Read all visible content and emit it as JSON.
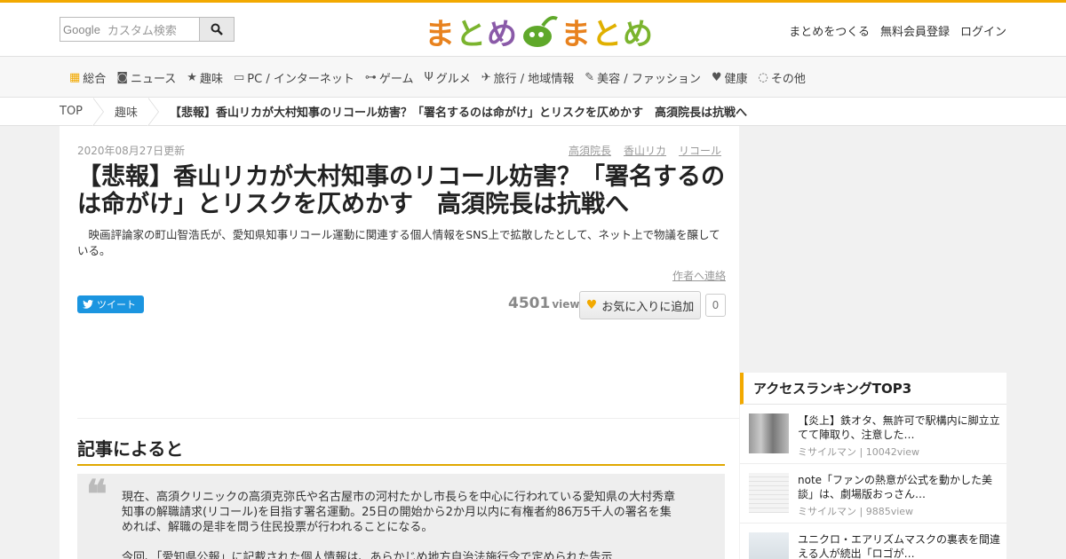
{
  "header": {
    "search_brand": "Google",
    "search_placeholder": "カスタム検索",
    "logo": [
      "ま",
      "と",
      "め",
      "ま",
      "と",
      "め"
    ],
    "links": [
      "まとめをつくる",
      "無料会員登録",
      "ログイン"
    ]
  },
  "colors": {
    "accent": "#f2a900",
    "tweet": "#1b95e0",
    "logo_orange": "#e8821e",
    "logo_green": "#7bb42e",
    "logo_purple": "#8a5aa8",
    "logo_yellow": "#e0b000"
  },
  "categories": [
    {
      "icon": "grid-icon",
      "label": "総合"
    },
    {
      "icon": "camera-icon",
      "label": "ニュース"
    },
    {
      "icon": "star-icon",
      "label": "趣味"
    },
    {
      "icon": "monitor-icon",
      "label": "PC / インターネット"
    },
    {
      "icon": "gamepad-icon",
      "label": "ゲーム"
    },
    {
      "icon": "utensils-icon",
      "label": "グルメ"
    },
    {
      "icon": "plane-icon",
      "label": "旅行 / 地域情報"
    },
    {
      "icon": "pen-icon",
      "label": "美容 / ファッション"
    },
    {
      "icon": "heartbeat-icon",
      "label": "健康"
    },
    {
      "icon": "shapes-icon",
      "label": "その他"
    }
  ],
  "breadcrumb": {
    "top": "TOP",
    "category": "趣味",
    "current": "【悲報】香山リカが大村知事のリコール妨害？「署名するのは命がけ」とリスクを仄めかす　高須院長は抗戦へ"
  },
  "article": {
    "date": "2020年08月27日更新",
    "tags": [
      "高須院長",
      "香山リカ",
      "リコール"
    ],
    "title": "【悲報】香山リカが大村知事のリコール妨害？「署名するのは命がけ」とリスクを仄めかす　高須院長は抗戦へ",
    "lead": "映画評論家の町山智浩氏が、愛知県知事リコール運動に関連する個人情報をSNS上で拡散したとして、ネット上で物議を醸している。",
    "contact": "作者へ連絡",
    "tweet": "ツイート",
    "views": "4501",
    "views_unit": "view",
    "fav_label": "お気に入りに追加",
    "fav_count": "0",
    "section_title": "記事によると",
    "quote": "現在、高須クリニックの高須克弥氏や名古屋市の河村たかし市長らを中心に行われている愛知県の大村秀章知事の解職請求(リコール)を目指す署名運動。25日の開始から2か月以内に有権者約86万5千人の署名を集めれば、解職の是非を問う住民投票が行われることになる。",
    "quote2": "今回、「愛知県公報」に記載された個人情報は、あらかじめ地方自治法施行令で定められた告示"
  },
  "ranking": {
    "title": "アクセスランキングTOP3",
    "items": [
      {
        "title": "【炎上】鉄オタ、無許可で駅構内に脚立立てて陣取り、注意した…",
        "meta": "ミサイルマン | 10042view"
      },
      {
        "title": "note「ファンの熱意が公式を動かした美談」は、劇場版おっさん…",
        "meta": "ミサイルマン | 9885view"
      },
      {
        "title": "ユニクロ・エアリズムマスクの裏表を間違える人が続出「ロゴが…",
        "meta": ""
      }
    ]
  }
}
